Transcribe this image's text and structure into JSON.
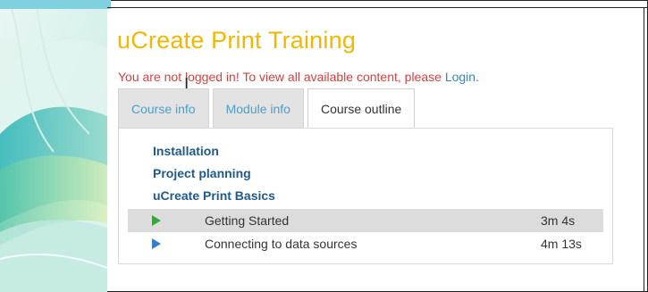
{
  "page": {
    "title": "uCreate Print Training",
    "notice_text": "You are not logged in! To view all available content, please ",
    "notice_link": "Login",
    "notice_end": "."
  },
  "tabs": [
    {
      "label": "Course info",
      "active": false
    },
    {
      "label": "Module info",
      "active": false
    },
    {
      "label": "Course outline",
      "active": true
    }
  ],
  "outline": {
    "modules": [
      "Installation",
      "Project planning",
      "uCreate Print Basics"
    ],
    "lessons": [
      {
        "title": "Getting Started",
        "duration": "3m 4s",
        "icon": "play-icon-green",
        "highlighted": true
      },
      {
        "title": "Connecting to data sources",
        "duration": "4m 13s",
        "icon": "play-icon-blue",
        "highlighted": false
      }
    ]
  },
  "colors": {
    "title": "#f2b705",
    "notice": "#d93f3f",
    "link": "#3a83b8",
    "tab_inactive_text": "#4d9fc9",
    "module_text": "#1f5a8a",
    "play_green": "#3aa53a",
    "play_blue": "#2f7fd0",
    "highlight_row": "#dcdcdc"
  }
}
